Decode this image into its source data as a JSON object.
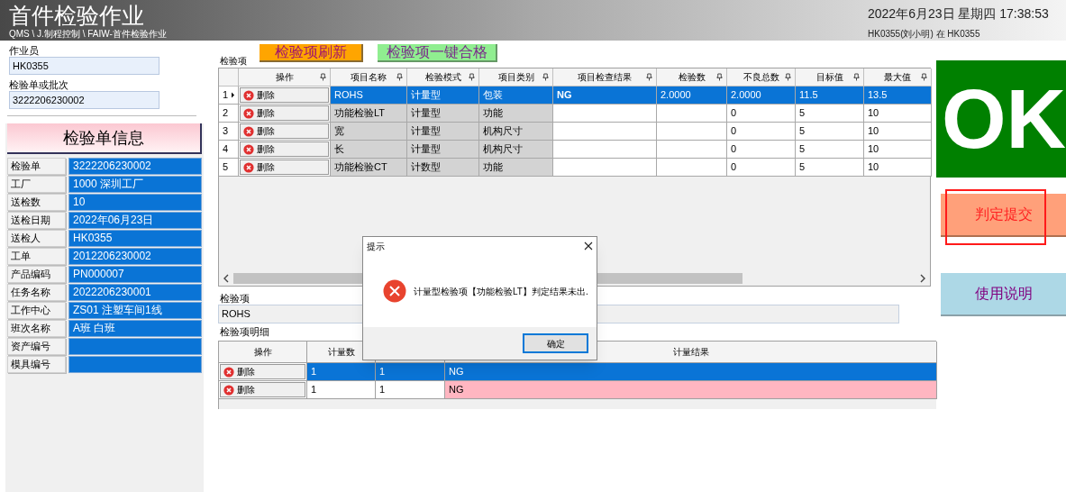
{
  "header": {
    "title": "首件检验作业",
    "breadcrumb": "QMS \\ J.制程控制 \\ FAIW-首件检验作业",
    "datetime": "2022年6月23日 星期四 17:38:53",
    "user": "HK0355(刘小明) 在 HK0355"
  },
  "operator": {
    "label": "作业员",
    "value": "HK0355"
  },
  "batch": {
    "label": "检验单或批次",
    "value": "3222206230002"
  },
  "info_panel": {
    "title": "检验单信息",
    "rows": [
      {
        "label": "检验单",
        "value": "3222206230002"
      },
      {
        "label": "工厂",
        "value": "1000 深圳工厂"
      },
      {
        "label": "送检数",
        "value": "10"
      },
      {
        "label": "送检日期",
        "value": "2022年06月23日"
      },
      {
        "label": "送检人",
        "value": "HK0355"
      },
      {
        "label": "工单",
        "value": "2012206230002"
      },
      {
        "label": "产品编码",
        "value": "PN000007"
      },
      {
        "label": "任务名称",
        "value": "2022206230001"
      },
      {
        "label": "工作中心",
        "value": "ZS01 注塑车间1线"
      },
      {
        "label": "班次名称",
        "value": "A班 白班"
      },
      {
        "label": "资产编号",
        "value": ""
      },
      {
        "label": "模具编号",
        "value": ""
      }
    ]
  },
  "items_section": {
    "label": "检验项",
    "buttons": [
      {
        "label": "检验项刷新",
        "kind": "refresh"
      },
      {
        "label": "检验项一键合格",
        "kind": "pass_all"
      }
    ]
  },
  "items_table": {
    "columns": [
      "操作",
      "项目名称",
      "检验模式",
      "项目类别",
      "项目检查结果",
      "检验数",
      "不良总数",
      "目标值",
      "最大值"
    ],
    "rows": [
      {
        "number": "1",
        "selected": true,
        "action": "删除",
        "cells": [
          "ROHS",
          "计量型",
          "包装",
          "NG",
          "2.0000",
          "2.0000",
          "11.5",
          "13.5"
        ]
      },
      {
        "number": "2",
        "selected": false,
        "action": "删除",
        "cells": [
          "功能检验LT",
          "计量型",
          "功能",
          "",
          "",
          "0",
          "5",
          "10"
        ]
      },
      {
        "number": "3",
        "selected": false,
        "action": "删除",
        "cells": [
          "宽",
          "计量型",
          "机构尺寸",
          "",
          "",
          "0",
          "5",
          "10"
        ]
      },
      {
        "number": "4",
        "selected": false,
        "action": "删除",
        "cells": [
          "长",
          "计量型",
          "机构尺寸",
          "",
          "",
          "0",
          "5",
          "10"
        ]
      },
      {
        "number": "5",
        "selected": false,
        "action": "删除",
        "cells": [
          "功能检验CT",
          "计数型",
          "功能",
          "",
          "",
          "0",
          "5",
          "10"
        ]
      }
    ]
  },
  "detail": {
    "label": "检验项",
    "value": "ROHS"
  },
  "detail_table": {
    "label": "检验项明细",
    "columns": [
      {
        "label": "操作",
        "kind": "text"
      },
      {
        "label": "计量数",
        "kind": "text"
      },
      {
        "kind": "covered"
      },
      {
        "label": "计量结果",
        "kind": "text"
      }
    ],
    "rows": [
      {
        "selected": true,
        "action": "删除",
        "cells": [
          "1",
          "1",
          "NG"
        ]
      },
      {
        "selected": false,
        "flagged": true,
        "action": "删除",
        "cells": [
          "1",
          "1",
          "NG"
        ]
      }
    ]
  },
  "verdict": {
    "text": "OK",
    "kind": "pass"
  },
  "actions": [
    {
      "label": "判定提交",
      "kind": "submit",
      "highlighted": true
    },
    {
      "label": "使用说明",
      "kind": "help",
      "highlighted": false
    }
  ],
  "dialog": {
    "title": "提示",
    "kind": "error",
    "message": "计量型检验项【功能检验LT】判定结果未出.",
    "button": "确定"
  }
}
